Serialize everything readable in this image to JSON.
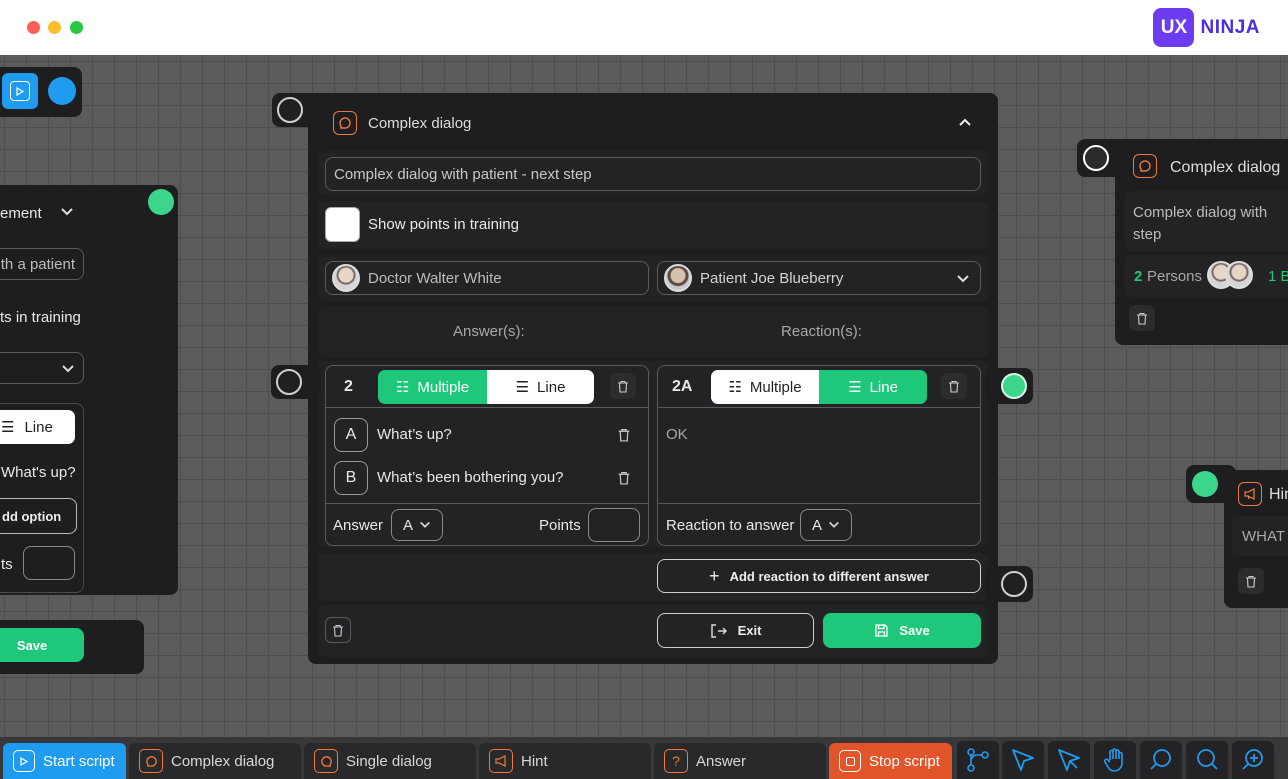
{
  "brand": {
    "logo_mark": "UX",
    "logo_text": "NINJA",
    "accent": "#1fc77a",
    "orange": "#f07a3e",
    "blue": "#1f9bf0"
  },
  "left_node": {
    "dropdown_text": "ement",
    "input_text": "th a patient",
    "points_label": "ts in training",
    "line_label": "Line",
    "option_text": "What's up?",
    "add_option": "dd option",
    "points_short": "ts",
    "save": "Save"
  },
  "main_node": {
    "title": "Complex dialog",
    "name_value": "Complex dialog with  patient - next step",
    "show_points": "Show points in training",
    "person_left": "Doctor Walter White",
    "person_right": "Patient Joe Blueberry",
    "answers_header": "Answer(s):",
    "reactions_header": "Reaction(s):",
    "answer_block": {
      "number": "2",
      "mode_multiple": "Multiple",
      "mode_line": "Line",
      "options": [
        {
          "letter": "A",
          "text": "What’s up?"
        },
        {
          "letter": "B",
          "text": "What’s been bothering you?"
        }
      ],
      "answer_label": "Answer",
      "answer_value": "A",
      "points_label": "Points"
    },
    "reaction_block": {
      "number": "2A",
      "mode_multiple": "Multiple",
      "mode_line": "Line",
      "text": "OK",
      "reaction_label": "Reaction to answer",
      "reaction_value": "A"
    },
    "add_reaction": "Add reaction to different answer",
    "exit": "Exit",
    "save": "Save"
  },
  "right_node": {
    "title": "Complex dialog",
    "text": "Complex dialog with step",
    "persons_count": "2",
    "persons_label": "Persons",
    "extra": "1 B"
  },
  "hint_node": {
    "title": "Hin",
    "text": "WHAT"
  },
  "bottom_bar": {
    "items": [
      {
        "label": "Start script",
        "icon": "play-icon"
      },
      {
        "label": "Complex dialog",
        "icon": "chat-icon"
      },
      {
        "label": "Single dialog",
        "icon": "bubble-icon"
      },
      {
        "label": "Hint",
        "icon": "megaphone-icon"
      },
      {
        "label": "Answer",
        "icon": "question-icon"
      },
      {
        "label": "Stop script",
        "icon": "stop-icon"
      }
    ],
    "tools": [
      "branch-icon",
      "cursor-icon",
      "cursor-outline-icon",
      "hand-icon",
      "search-icon",
      "search-alt-icon",
      "zoom-in-icon"
    ]
  }
}
